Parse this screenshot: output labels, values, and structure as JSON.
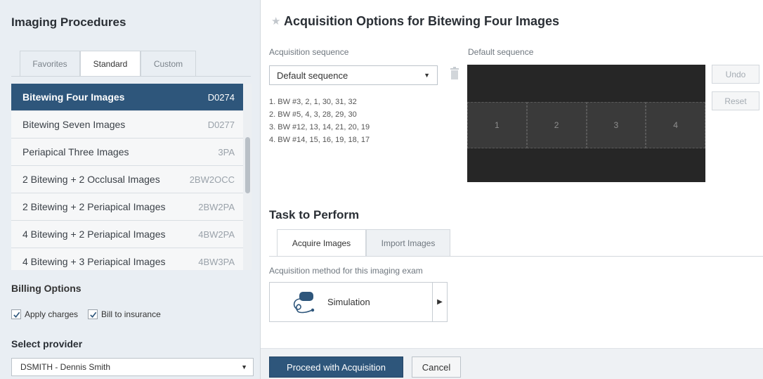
{
  "left_panel": {
    "title": "Imaging Procedures",
    "tabs": [
      {
        "label": "Favorites",
        "active": false
      },
      {
        "label": "Standard",
        "active": true
      },
      {
        "label": "Custom",
        "active": false
      }
    ],
    "procedures": [
      {
        "name": "Bitewing Four Images",
        "code": "D0274",
        "selected": true
      },
      {
        "name": "Bitewing Seven Images",
        "code": "D0277",
        "selected": false
      },
      {
        "name": "Periapical Three Images",
        "code": "3PA",
        "selected": false
      },
      {
        "name": "2 Bitewing + 2 Occlusal Images",
        "code": "2BW2OCC",
        "selected": false
      },
      {
        "name": "2 Bitewing + 2 Periapical Images",
        "code": "2BW2PA",
        "selected": false
      },
      {
        "name": "4 Bitewing + 2 Periapical Images",
        "code": "4BW2PA",
        "selected": false
      },
      {
        "name": "4 Bitewing + 3 Periapical Images",
        "code": "4BW3PA",
        "selected": false
      }
    ],
    "billing": {
      "title": "Billing Options",
      "apply_charges": {
        "label": "Apply charges",
        "checked": true
      },
      "bill_insurance": {
        "label": "Bill to insurance",
        "checked": true
      }
    },
    "provider": {
      "title": "Select provider",
      "value": "DSMITH - Dennis Smith"
    }
  },
  "main": {
    "title": "Acquisition Options for Bitewing Four Images",
    "acquisition_sequence": {
      "label": "Acquisition sequence",
      "value": "Default sequence",
      "steps": [
        "1. BW  #3, 2, 1, 30, 31, 32",
        "2. BW  #5, 4, 3, 28, 29, 30",
        "3. BW  #12, 13, 14, 21, 20, 19",
        "4. BW  #14, 15, 16, 19, 18, 17"
      ]
    },
    "default_sequence": {
      "label": "Default sequence",
      "slots": [
        "1",
        "2",
        "3",
        "4"
      ],
      "undo_label": "Undo",
      "reset_label": "Reset"
    },
    "task": {
      "title": "Task to Perform",
      "tabs": [
        {
          "label": "Acquire Images",
          "active": true
        },
        {
          "label": "Import Images",
          "active": false
        }
      ],
      "method_label": "Acquisition method for this imaging exam",
      "method_name": "Simulation"
    },
    "footer": {
      "proceed_label": "Proceed with Acquisition",
      "cancel_label": "Cancel"
    }
  },
  "colors": {
    "accent": "#2e567b",
    "panel_bg": "#e9eef3",
    "canvas_bg": "#262626"
  }
}
